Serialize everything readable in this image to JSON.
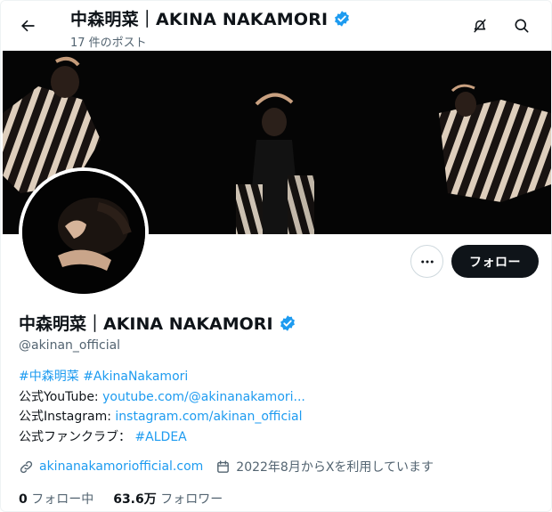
{
  "header": {
    "name": "中森明菜｜AKINA NAKAMORI",
    "post_count": "17 件のポスト"
  },
  "actions": {
    "follow_label": "フォロー"
  },
  "profile": {
    "name": "中森明菜｜AKINA NAKAMORI",
    "handle": "@akinan_official",
    "bio": {
      "hashtag1": "#中森明菜",
      "hashtag2": "#AkinaNakamori",
      "youtube_prefix": "公式YouTube:",
      "youtube_link": "youtube.com/@akinanakamori...",
      "instagram_prefix": "公式Instagram:",
      "instagram_link": "instagram.com/akinan_official",
      "fanclub_prefix": "公式ファンクラブ：",
      "fanclub_link": "#ALDEA"
    },
    "website": "akinanakamoriofficial.com",
    "joined": "2022年8月からXを利用しています",
    "following_count": "0",
    "following_label": "フォロー中",
    "followers_count": "63.6万",
    "followers_label": "フォロワー"
  },
  "colors": {
    "accent": "#1d9bf0",
    "text": "#0f1419",
    "muted": "#536471",
    "verified": "#1d9bf0"
  },
  "icons": [
    "back-arrow-icon",
    "verified-badge-icon",
    "notification-off-icon",
    "search-icon",
    "more-icon",
    "link-icon",
    "calendar-icon"
  ]
}
